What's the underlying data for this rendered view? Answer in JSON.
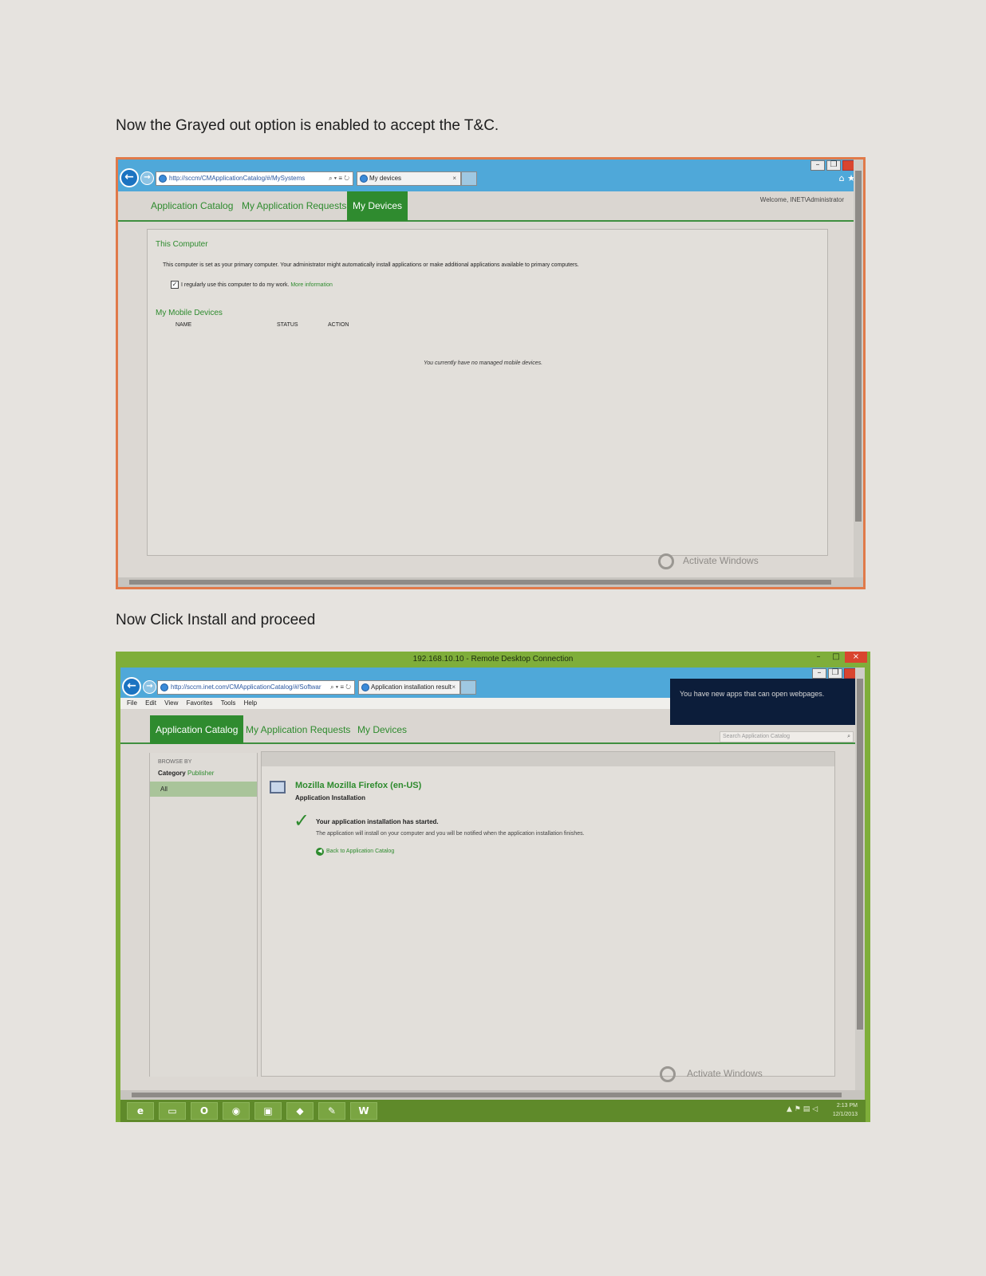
{
  "captions": {
    "first": "Now the Grayed out option is enabled to accept the T&C.",
    "second": "Now Click Install and proceed"
  },
  "shot1": {
    "address_url": "http://sccm/CMApplicationCatalog/#/MySystems",
    "address_tools": "⌕ ▾ ≡ ↻",
    "tab_title": "My devices",
    "tab_close": "×",
    "nav_tabs": [
      "Application Catalog",
      "My Application Requests",
      "My Devices"
    ],
    "active_tab": "My Devices",
    "welcome": "Welcome, INET\\Administrator",
    "this_computer": {
      "title": "This Computer",
      "description": "This computer is set as your primary computer. Your administrator might automatically install applications or make additional applications available to primary computers.",
      "checkbox_label": "I regularly use this computer to do my work.",
      "checkbox_checked": true,
      "more_info": "More information"
    },
    "mobile_devices": {
      "title": "My Mobile Devices",
      "columns": [
        "NAME",
        "STATUS",
        "ACTION"
      ],
      "empty_message": "You currently have no managed mobile devices."
    },
    "activate_windows": "Activate Windows"
  },
  "shot2": {
    "rd_title": "192.168.10.10 - Remote Desktop Connection",
    "address_url": "http://sccm.inet.com/CMApplicationCatalog/#/Softwar",
    "address_tools": "⌕ ▾ ≡ ↻",
    "tab_title": "Application installation result",
    "tab_close": "×",
    "menu": [
      "File",
      "Edit",
      "View",
      "Favorites",
      "Tools",
      "Help"
    ],
    "toast": "You have new apps that can open webpages.",
    "nav_tabs": [
      "Application Catalog",
      "My Application Requests",
      "My Devices"
    ],
    "active_tab": "Application Catalog",
    "search_placeholder": "Search Application Catalog",
    "sidebar": {
      "browse_by": "BROWSE BY",
      "category": "Category",
      "publisher": "Publisher",
      "all": "All"
    },
    "app": {
      "title": "Mozilla Mozilla Firefox (en-US)",
      "subtitle": "Application Installation",
      "status": "Your application installation has started.",
      "detail": "The application will install on your computer and you will be notified when the application installation finishes.",
      "back_link": "Back to Application Catalog"
    },
    "activate_windows": "Activate Windows",
    "tray": {
      "time": "2:13 PM",
      "date": "12/1/2013"
    },
    "taskbar_icons": [
      "ie-icon",
      "explorer-icon",
      "outlook-icon",
      "chrome-icon",
      "remote-icon",
      "app-icon",
      "paint-icon",
      "word-icon"
    ]
  }
}
